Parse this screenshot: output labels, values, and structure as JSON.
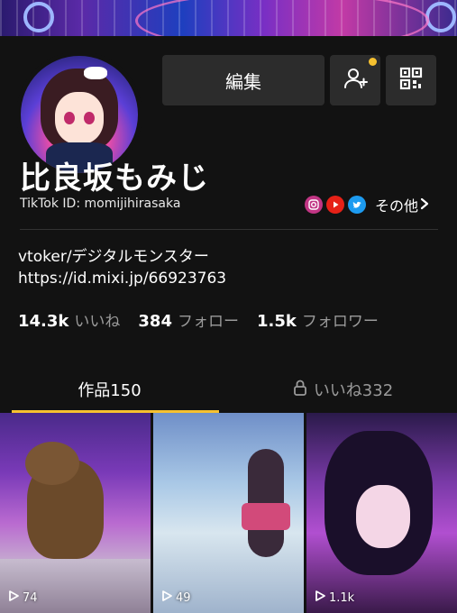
{
  "profile": {
    "display_name": "比良坂もみじ",
    "tiktok_id": "TikTok ID: momijihirasaka",
    "edit_label": "編集",
    "other_label": "その他",
    "bio_line1": "vtoker/デジタルモンスター",
    "bio_line2": "https://id.mixi.jp/66923763",
    "icons": {
      "add_friend": "add-user-icon",
      "qr": "qr-code-icon",
      "instagram": "instagram-icon",
      "youtube": "youtube-icon",
      "twitter": "twitter-icon",
      "chevron": "chevron-right-icon"
    }
  },
  "stats": [
    {
      "value": "14.3k",
      "label": "いいね"
    },
    {
      "value": "384",
      "label": "フォロー"
    },
    {
      "value": "1.5k",
      "label": "フォロワー"
    }
  ],
  "tabs": {
    "works": "作品150",
    "likes": "いいね332"
  },
  "videos": [
    {
      "views": "74"
    },
    {
      "views": "49"
    },
    {
      "views": "1.1k"
    }
  ],
  "colors": {
    "background": "#121212",
    "button": "#2c2c2c",
    "accent": "#f6c130",
    "muted_text": "#9a9a9a",
    "instagram": "#c13584",
    "youtube": "#e62117",
    "twitter": "#1d9bf0"
  }
}
